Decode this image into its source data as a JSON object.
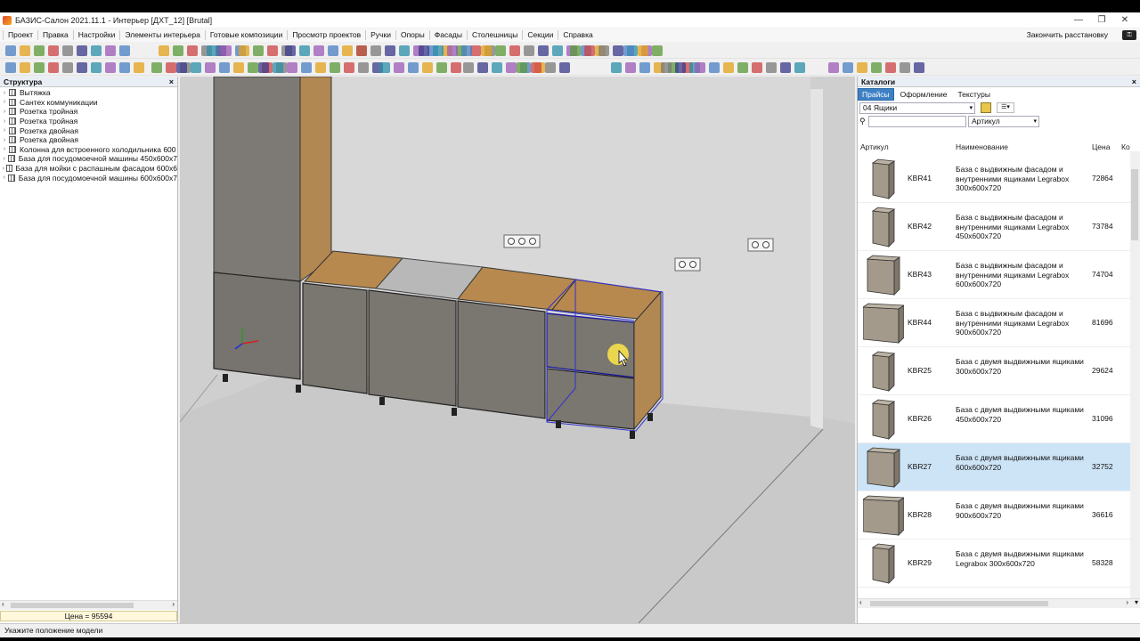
{
  "window": {
    "title": "БАЗИС-Салон 2021.11.1 - Интерьер [ДХТ_12] [Brutal]",
    "minimize": "—",
    "restore": "❐",
    "close": "✕"
  },
  "menu": {
    "items": [
      "Проект",
      "Правка",
      "Настройки",
      "Элементы интерьера",
      "Готовые композиции",
      "Просмотр проектов",
      "Ручки",
      "Опоры",
      "Фасады",
      "Столешницы",
      "Секции",
      "Справка"
    ],
    "finish_label": "Закончить расстановку",
    "key_icon": "key-icon"
  },
  "structure": {
    "title": "Структура",
    "close": "×",
    "items": [
      "Вытяжка",
      "Сантех коммуникации",
      "Розетка тройная",
      "Розетка тройная",
      "Розетка двойная",
      "Розетка двойная",
      "Колонна для встроенного холодильника 600",
      "База для посудомоечной машины 450x600x7",
      "База для мойки с распашным фасадом 600x6",
      "База для посудомоечной машины 600x600x7"
    ],
    "price": "Цена = 95594"
  },
  "catalog": {
    "title": "Каталоги",
    "close": "×",
    "tabs": [
      "Прайсы",
      "Оформление",
      "Текстуры"
    ],
    "active_tab": "Прайсы",
    "category": "04 Ящики",
    "search_field": "Артикул",
    "columns": [
      "Артикул",
      "Наименование",
      "Цена",
      "Ко"
    ],
    "rows": [
      {
        "article": "KBR41",
        "name": "База с выдвижным фасадом и внутренними ящиками Legrabox 300x600x720",
        "price": "72864",
        "thumb": "narrow"
      },
      {
        "article": "KBR42",
        "name": "База с выдвижным фасадом и внутренними ящиками Legrabox 450x600x720",
        "price": "73784",
        "thumb": "narrow"
      },
      {
        "article": "KBR43",
        "name": "База с выдвижным фасадом и внутренними ящиками Legrabox 600x600x720",
        "price": "74704",
        "thumb": "medium"
      },
      {
        "article": "KBR44",
        "name": "База с выдвижным фасадом и внутренними ящиками Legrabox 900x600x720",
        "price": "81696",
        "thumb": "wide"
      },
      {
        "article": "KBR25",
        "name": "База с двумя выдвижными ящиками 300x600x720",
        "price": "29624",
        "thumb": "narrow"
      },
      {
        "article": "KBR26",
        "name": "База с двумя выдвижными ящиками 450x600x720",
        "price": "31096",
        "thumb": "narrow"
      },
      {
        "article": "KBR27",
        "name": "База с двумя выдвижными ящиками 600x600x720",
        "price": "32752",
        "thumb": "medium"
      },
      {
        "article": "KBR28",
        "name": "База с двумя выдвижными ящиками 900x600x720",
        "price": "36616",
        "thumb": "wide"
      },
      {
        "article": "KBR29",
        "name": "База с двумя выдвижными ящиками Legrabox 300x600x720",
        "price": "58328",
        "thumb": "narrow"
      }
    ],
    "selected_index": 6
  },
  "status": {
    "text": "Укажите положение модели"
  },
  "colors": {
    "cabinet_front": "#7a7670",
    "worktop": "#b58b55",
    "wall": "#d9d9d9",
    "floor": "#c8c8c8",
    "selection": "#2424c8",
    "tab_active": "#3d80c4",
    "row_selected": "#cde4f7"
  }
}
